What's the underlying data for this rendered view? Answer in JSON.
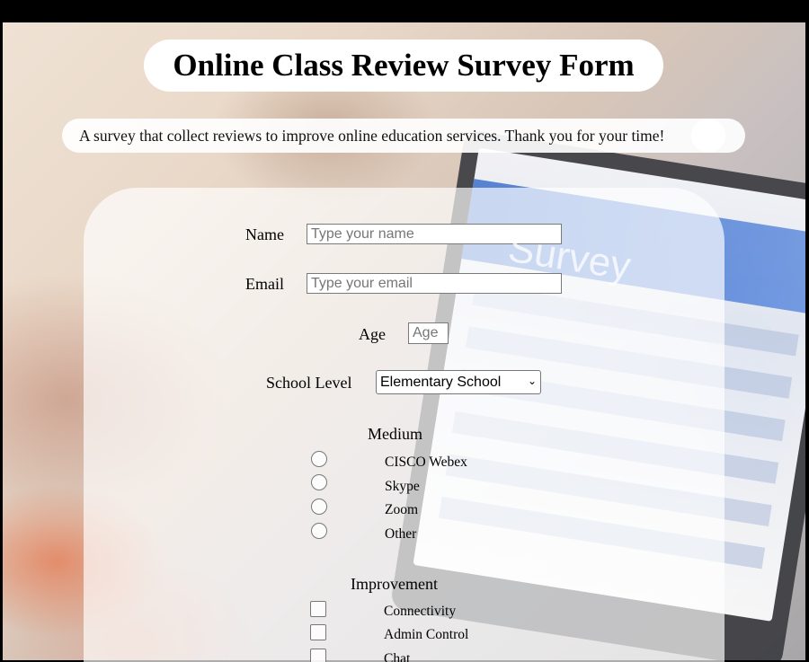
{
  "header": {
    "title": "Online Class Review Survey Form",
    "description": "A survey that collect reviews to improve online education services. Thank you for your time!"
  },
  "form": {
    "name": {
      "label": "Name",
      "placeholder": "Type your name"
    },
    "email": {
      "label": "Email",
      "placeholder": "Type your email"
    },
    "age": {
      "label": "Age",
      "placeholder": "Age"
    },
    "school_level": {
      "label": "School Level",
      "selected": "Elementary School"
    },
    "medium": {
      "title": "Medium",
      "options": [
        "CISCO Webex",
        "Skype",
        "Zoom",
        "Other"
      ]
    },
    "improvement": {
      "title": "Improvement",
      "options": [
        "Connectivity",
        "Admin Control",
        "Chat"
      ]
    }
  },
  "background": {
    "screen_text": "Survey"
  }
}
